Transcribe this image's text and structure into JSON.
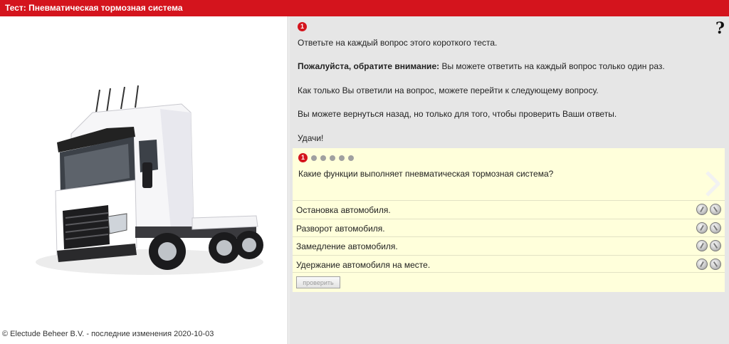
{
  "window": {
    "title": "Тест: Пневматическая тормозная система"
  },
  "badge_number": "1",
  "help_icon_glyph": "?",
  "instructions": {
    "line1": "Ответьте на каждый вопрос этого короткого теста.",
    "notice_bold": "Пожалуйста, обратите внимание:",
    "notice_rest": " Вы можете ответить на каждый вопрос только один раз.",
    "line3": "Как только Вы ответили на вопрос, можете перейти к следующему вопросу.",
    "line4": "Вы можете вернуться назад, но только для того, чтобы проверить Ваши ответы.",
    "line5": "Удачи!"
  },
  "quiz": {
    "current_question": "1",
    "total_questions": 6,
    "question": "Какие функции выполняет пневматическая тормозная система?",
    "answers": [
      {
        "label": "Остановка автомобиля."
      },
      {
        "label": "Разворот автомобиля."
      },
      {
        "label": "Замедление автомобиля."
      },
      {
        "label": "Удержание автомобиля на месте."
      }
    ],
    "check_button": "проверить"
  },
  "footer": {
    "text": "© Electude Beheer B.V. - последние изменения 2020-10-03"
  },
  "colors": {
    "brand_red": "#d4141d",
    "quiz_bg": "#ffffdb",
    "panel_bg": "#e6e6e6"
  }
}
